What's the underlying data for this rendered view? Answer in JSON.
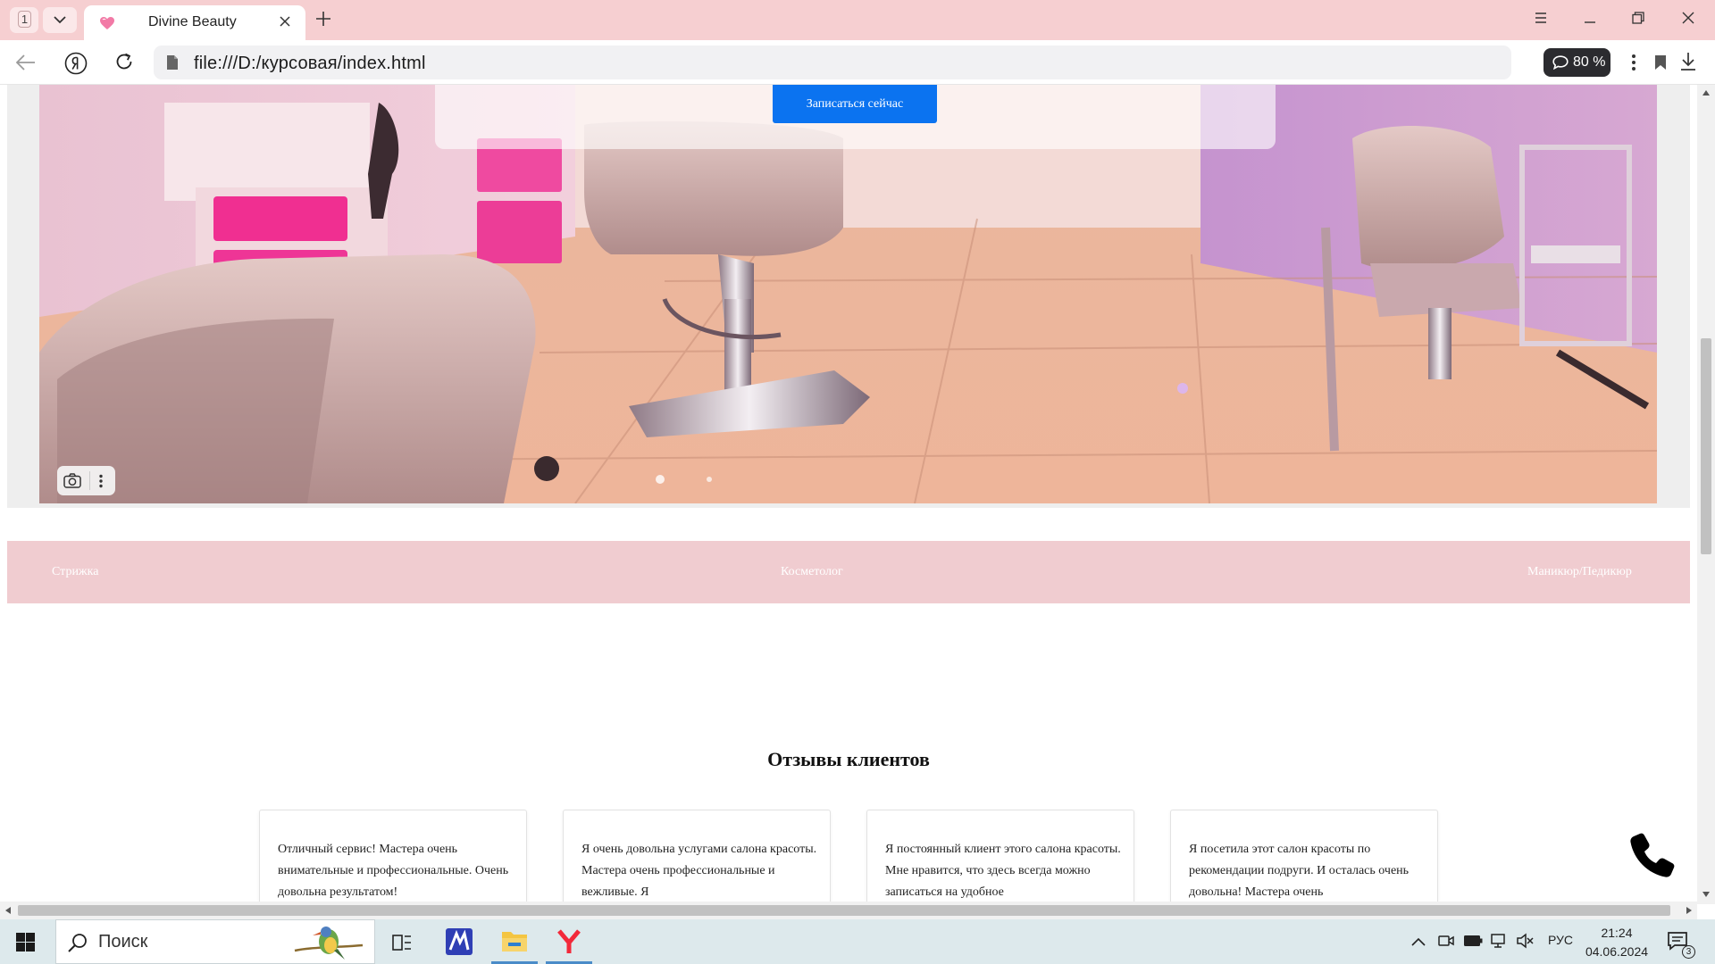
{
  "browser": {
    "tab_counter": "1",
    "tab_title": "Divine Beauty",
    "url": "file:///D:/курсовая/index.html",
    "zoom_label": "80 %",
    "accent": "#f6cfd1"
  },
  "hero": {
    "cta_label": "Записаться сейчас",
    "cta_color": "#0b73f0"
  },
  "services": {
    "items": [
      "Стрижка",
      "Косметолог",
      "Маникюр/Педикюр"
    ],
    "bar_color": "#f0ccd0"
  },
  "reviews": {
    "title": "Отзывы клиентов",
    "cards": [
      "Отличный сервис! Мастера очень внимательные и профессиональные. Очень довольна результатом!",
      "Я очень довольна услугами салона красоты. Мастера очень профессиональные и вежливые. Я",
      "Я постоянный клиент этого салона красоты. Мне нравится, что здесь всегда можно записаться на удобное",
      "Я посетила этот салон красоты по рекомендации подруги. И осталась очень довольна! Мастера очень"
    ]
  },
  "taskbar": {
    "search_label": "Поиск",
    "language": "РУС",
    "time": "21:24",
    "date": "04.06.2024",
    "notification_count": "3"
  }
}
